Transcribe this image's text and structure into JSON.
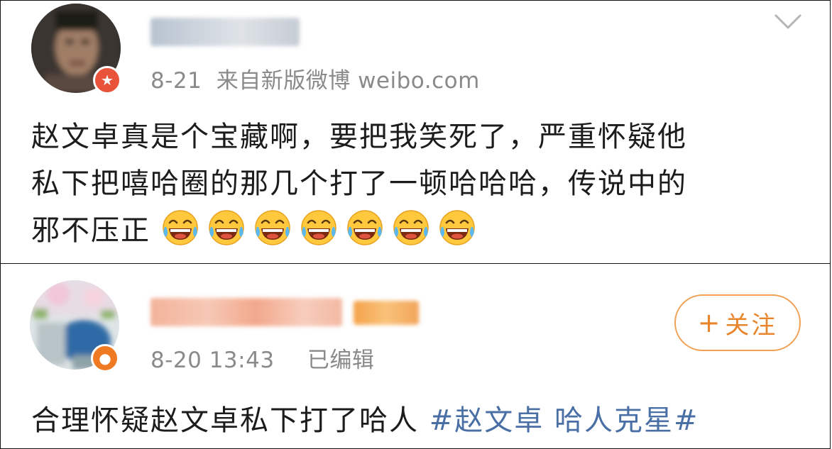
{
  "posts": [
    {
      "meta_date": "8-21",
      "meta_source": "来自新版微博 weibo.com",
      "content_lines": [
        "赵文卓真是个宝藏啊，要把我笑死了，严重怀疑他",
        "私下把嘻哈圈的那几个打了一顿哈哈哈，传说中的",
        "邪不压正"
      ],
      "emoji_name": "laughing-crying-emoji",
      "emoji_count": 7
    },
    {
      "meta_date": "8-20 13:43",
      "meta_edited": "已编辑",
      "follow_plus": "+",
      "follow_label": "关注",
      "content_text": "合理怀疑赵文卓私下打了哈人 ",
      "hashtag_text": "#赵文卓 哈人克星#"
    }
  ],
  "colors": {
    "accent_orange": "#e8852d",
    "hashtag_blue": "#4a6fa5",
    "meta_gray": "#8a8a8a",
    "badge_red": "#e8533a"
  }
}
